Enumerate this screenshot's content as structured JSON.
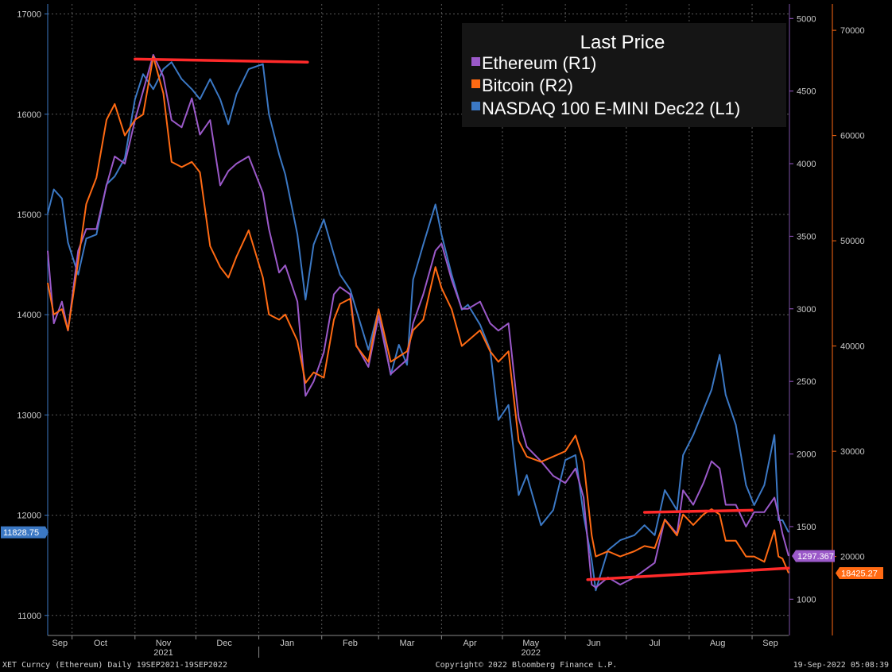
{
  "chart_data": {
    "type": "line",
    "legend": {
      "title": "Last Price",
      "placement": "top-right",
      "items": [
        "Ethereum  (R1)",
        "Bitcoin  (R2)",
        "NASDAQ 100 E-MINI Dec22  (L1)"
      ]
    },
    "axes": {
      "left": {
        "ticks": [
          11000,
          12000,
          13000,
          14000,
          15000,
          16000,
          17000
        ],
        "range": [
          10800,
          17100
        ]
      },
      "right1": {
        "ticks": [
          1000,
          1500,
          2000,
          2500,
          3000,
          3500,
          4000,
          4500,
          5000
        ],
        "range": [
          750,
          5100
        ]
      },
      "right2": {
        "ticks": [
          20000,
          30000,
          40000,
          50000,
          60000,
          70000
        ],
        "range": [
          12500,
          72500
        ]
      }
    },
    "x": {
      "start": "2021-09-19",
      "end": "2022-09-19",
      "month_labels": [
        "Sep",
        "Oct",
        "Nov",
        "Dec",
        "Jan",
        "Feb",
        "Mar",
        "Apr",
        "May",
        "Jun",
        "Jul",
        "Aug",
        "Sep"
      ],
      "year_labels": [
        "2021",
        "2022"
      ],
      "grid": true
    },
    "series": [
      {
        "name": "NASDAQ 100 E-MINI Dec22",
        "axis": "left",
        "color": "#3b78c4",
        "points": [
          [
            "2021-09-19",
            15010
          ],
          [
            "2021-09-22",
            15250
          ],
          [
            "2021-09-26",
            15160
          ],
          [
            "2021-09-29",
            14720
          ],
          [
            "2021-10-04",
            14400
          ],
          [
            "2021-10-08",
            14760
          ],
          [
            "2021-10-13",
            14800
          ],
          [
            "2021-10-18",
            15300
          ],
          [
            "2021-10-22",
            15380
          ],
          [
            "2021-10-27",
            15560
          ],
          [
            "2021-11-01",
            16150
          ],
          [
            "2021-11-05",
            16400
          ],
          [
            "2021-11-10",
            16250
          ],
          [
            "2021-11-15",
            16450
          ],
          [
            "2021-11-19",
            16520
          ],
          [
            "2021-11-24",
            16350
          ],
          [
            "2021-11-29",
            16250
          ],
          [
            "2021-12-03",
            16150
          ],
          [
            "2021-12-08",
            16350
          ],
          [
            "2021-12-13",
            16150
          ],
          [
            "2021-12-17",
            15900
          ],
          [
            "2021-12-21",
            16200
          ],
          [
            "2021-12-27",
            16450
          ],
          [
            "2022-01-03",
            16500
          ],
          [
            "2022-01-06",
            16000
          ],
          [
            "2022-01-11",
            15600
          ],
          [
            "2022-01-14",
            15400
          ],
          [
            "2022-01-20",
            14800
          ],
          [
            "2022-01-24",
            14150
          ],
          [
            "2022-01-28",
            14700
          ],
          [
            "2022-02-02",
            14950
          ],
          [
            "2022-02-07",
            14600
          ],
          [
            "2022-02-10",
            14400
          ],
          [
            "2022-02-15",
            14250
          ],
          [
            "2022-02-18",
            14050
          ],
          [
            "2022-02-24",
            13650
          ],
          [
            "2022-03-01",
            14050
          ],
          [
            "2022-03-07",
            13400
          ],
          [
            "2022-03-11",
            13700
          ],
          [
            "2022-03-15",
            13500
          ],
          [
            "2022-03-18",
            14350
          ],
          [
            "2022-03-23",
            14700
          ],
          [
            "2022-03-29",
            15100
          ],
          [
            "2022-04-01",
            14800
          ],
          [
            "2022-04-06",
            14400
          ],
          [
            "2022-04-11",
            14050
          ],
          [
            "2022-04-14",
            14100
          ],
          [
            "2022-04-20",
            13900
          ],
          [
            "2022-04-25",
            13650
          ],
          [
            "2022-04-29",
            12950
          ],
          [
            "2022-05-04",
            13100
          ],
          [
            "2022-05-09",
            12200
          ],
          [
            "2022-05-13",
            12400
          ],
          [
            "2022-05-20",
            11900
          ],
          [
            "2022-05-26",
            12050
          ],
          [
            "2022-06-01",
            12550
          ],
          [
            "2022-06-06",
            12600
          ],
          [
            "2022-06-10",
            12000
          ],
          [
            "2022-06-14",
            11550
          ],
          [
            "2022-06-16",
            11250
          ],
          [
            "2022-06-22",
            11650
          ],
          [
            "2022-06-28",
            11750
          ],
          [
            "2022-07-05",
            11800
          ],
          [
            "2022-07-10",
            11900
          ],
          [
            "2022-07-15",
            11800
          ],
          [
            "2022-07-20",
            12250
          ],
          [
            "2022-07-26",
            12050
          ],
          [
            "2022-07-29",
            12600
          ],
          [
            "2022-08-03",
            12800
          ],
          [
            "2022-08-08",
            13050
          ],
          [
            "2022-08-12",
            13250
          ],
          [
            "2022-08-16",
            13600
          ],
          [
            "2022-08-19",
            13200
          ],
          [
            "2022-08-24",
            12900
          ],
          [
            "2022-08-29",
            12300
          ],
          [
            "2022-09-02",
            12100
          ],
          [
            "2022-09-07",
            12300
          ],
          [
            "2022-09-12",
            12800
          ],
          [
            "2022-09-14",
            11950
          ],
          [
            "2022-09-16",
            11950
          ],
          [
            "2022-09-19",
            11828.75
          ]
        ]
      },
      {
        "name": "Ethereum",
        "axis": "right1",
        "color": "#9b59c9",
        "points": [
          [
            "2021-09-19",
            3400
          ],
          [
            "2021-09-22",
            2900
          ],
          [
            "2021-09-26",
            3050
          ],
          [
            "2021-09-29",
            2850
          ],
          [
            "2021-10-04",
            3400
          ],
          [
            "2021-10-08",
            3550
          ],
          [
            "2021-10-13",
            3550
          ],
          [
            "2021-10-18",
            3850
          ],
          [
            "2021-10-22",
            4050
          ],
          [
            "2021-10-27",
            4000
          ],
          [
            "2021-11-01",
            4300
          ],
          [
            "2021-11-05",
            4500
          ],
          [
            "2021-11-10",
            4750
          ],
          [
            "2021-11-15",
            4600
          ],
          [
            "2021-11-19",
            4300
          ],
          [
            "2021-11-24",
            4250
          ],
          [
            "2021-11-29",
            4450
          ],
          [
            "2021-12-03",
            4200
          ],
          [
            "2021-12-08",
            4300
          ],
          [
            "2021-12-13",
            3850
          ],
          [
            "2021-12-17",
            3950
          ],
          [
            "2021-12-21",
            4000
          ],
          [
            "2021-12-27",
            4050
          ],
          [
            "2022-01-03",
            3800
          ],
          [
            "2022-01-06",
            3550
          ],
          [
            "2022-01-11",
            3250
          ],
          [
            "2022-01-14",
            3300
          ],
          [
            "2022-01-20",
            3050
          ],
          [
            "2022-01-24",
            2400
          ],
          [
            "2022-01-28",
            2500
          ],
          [
            "2022-02-02",
            2700
          ],
          [
            "2022-02-07",
            3100
          ],
          [
            "2022-02-10",
            3150
          ],
          [
            "2022-02-15",
            3100
          ],
          [
            "2022-02-18",
            2750
          ],
          [
            "2022-02-24",
            2600
          ],
          [
            "2022-03-01",
            2950
          ],
          [
            "2022-03-07",
            2550
          ],
          [
            "2022-03-11",
            2600
          ],
          [
            "2022-03-15",
            2650
          ],
          [
            "2022-03-18",
            2900
          ],
          [
            "2022-03-23",
            3100
          ],
          [
            "2022-03-29",
            3400
          ],
          [
            "2022-04-01",
            3450
          ],
          [
            "2022-04-06",
            3200
          ],
          [
            "2022-04-11",
            3000
          ],
          [
            "2022-04-14",
            3000
          ],
          [
            "2022-04-20",
            3050
          ],
          [
            "2022-04-25",
            2900
          ],
          [
            "2022-04-29",
            2850
          ],
          [
            "2022-05-04",
            2900
          ],
          [
            "2022-05-09",
            2250
          ],
          [
            "2022-05-13",
            2050
          ],
          [
            "2022-05-20",
            1950
          ],
          [
            "2022-05-26",
            1850
          ],
          [
            "2022-06-01",
            1800
          ],
          [
            "2022-06-06",
            1900
          ],
          [
            "2022-06-10",
            1700
          ],
          [
            "2022-06-14",
            1100
          ],
          [
            "2022-06-16",
            1080
          ],
          [
            "2022-06-22",
            1150
          ],
          [
            "2022-06-28",
            1100
          ],
          [
            "2022-07-05",
            1150
          ],
          [
            "2022-07-10",
            1200
          ],
          [
            "2022-07-15",
            1250
          ],
          [
            "2022-07-20",
            1550
          ],
          [
            "2022-07-26",
            1450
          ],
          [
            "2022-07-29",
            1750
          ],
          [
            "2022-08-03",
            1650
          ],
          [
            "2022-08-08",
            1800
          ],
          [
            "2022-08-12",
            1950
          ],
          [
            "2022-08-16",
            1900
          ],
          [
            "2022-08-19",
            1650
          ],
          [
            "2022-08-24",
            1650
          ],
          [
            "2022-08-29",
            1500
          ],
          [
            "2022-09-02",
            1600
          ],
          [
            "2022-09-07",
            1600
          ],
          [
            "2022-09-12",
            1700
          ],
          [
            "2022-09-14",
            1580
          ],
          [
            "2022-09-16",
            1450
          ],
          [
            "2022-09-19",
            1297.367
          ]
        ]
      },
      {
        "name": "Bitcoin",
        "axis": "right2",
        "color": "#ff6a13",
        "points": [
          [
            "2021-09-19",
            46000
          ],
          [
            "2021-09-22",
            43000
          ],
          [
            "2021-09-26",
            43500
          ],
          [
            "2021-09-29",
            41500
          ],
          [
            "2021-10-04",
            48000
          ],
          [
            "2021-10-08",
            53500
          ],
          [
            "2021-10-13",
            56000
          ],
          [
            "2021-10-18",
            61500
          ],
          [
            "2021-10-22",
            63000
          ],
          [
            "2021-10-27",
            60000
          ],
          [
            "2021-11-01",
            61500
          ],
          [
            "2021-11-05",
            62000
          ],
          [
            "2021-11-10",
            67500
          ],
          [
            "2021-11-15",
            64000
          ],
          [
            "2021-11-19",
            57500
          ],
          [
            "2021-11-24",
            57000
          ],
          [
            "2021-11-29",
            57500
          ],
          [
            "2021-12-03",
            56500
          ],
          [
            "2021-12-08",
            49500
          ],
          [
            "2021-12-13",
            47500
          ],
          [
            "2021-12-17",
            46500
          ],
          [
            "2021-12-21",
            48500
          ],
          [
            "2021-12-27",
            51000
          ],
          [
            "2022-01-03",
            46500
          ],
          [
            "2022-01-06",
            43000
          ],
          [
            "2022-01-11",
            42500
          ],
          [
            "2022-01-14",
            43000
          ],
          [
            "2022-01-20",
            40500
          ],
          [
            "2022-01-24",
            36500
          ],
          [
            "2022-01-28",
            37500
          ],
          [
            "2022-02-02",
            37000
          ],
          [
            "2022-02-07",
            42500
          ],
          [
            "2022-02-10",
            44000
          ],
          [
            "2022-02-15",
            44500
          ],
          [
            "2022-02-18",
            40000
          ],
          [
            "2022-02-24",
            38500
          ],
          [
            "2022-03-01",
            43500
          ],
          [
            "2022-03-07",
            38500
          ],
          [
            "2022-03-11",
            39000
          ],
          [
            "2022-03-15",
            39500
          ],
          [
            "2022-03-18",
            41500
          ],
          [
            "2022-03-23",
            42500
          ],
          [
            "2022-03-29",
            47500
          ],
          [
            "2022-04-01",
            45500
          ],
          [
            "2022-04-06",
            43500
          ],
          [
            "2022-04-11",
            40000
          ],
          [
            "2022-04-14",
            40500
          ],
          [
            "2022-04-20",
            41500
          ],
          [
            "2022-04-25",
            39500
          ],
          [
            "2022-04-29",
            38500
          ],
          [
            "2022-05-04",
            39500
          ],
          [
            "2022-05-09",
            31000
          ],
          [
            "2022-05-13",
            29500
          ],
          [
            "2022-05-20",
            29000
          ],
          [
            "2022-05-26",
            29500
          ],
          [
            "2022-06-01",
            30000
          ],
          [
            "2022-06-06",
            31500
          ],
          [
            "2022-06-10",
            29000
          ],
          [
            "2022-06-14",
            22000
          ],
          [
            "2022-06-16",
            20000
          ],
          [
            "2022-06-22",
            20500
          ],
          [
            "2022-06-28",
            20000
          ],
          [
            "2022-07-05",
            20500
          ],
          [
            "2022-07-10",
            21000
          ],
          [
            "2022-07-15",
            20800
          ],
          [
            "2022-07-20",
            23500
          ],
          [
            "2022-07-26",
            22000
          ],
          [
            "2022-07-29",
            24000
          ],
          [
            "2022-08-03",
            23000
          ],
          [
            "2022-08-08",
            24000
          ],
          [
            "2022-08-12",
            24500
          ],
          [
            "2022-08-16",
            24000
          ],
          [
            "2022-08-19",
            21500
          ],
          [
            "2022-08-24",
            21500
          ],
          [
            "2022-08-29",
            20000
          ],
          [
            "2022-09-02",
            20000
          ],
          [
            "2022-09-07",
            19500
          ],
          [
            "2022-09-12",
            22500
          ],
          [
            "2022-09-14",
            20000
          ],
          [
            "2022-09-16",
            19800
          ],
          [
            "2022-09-19",
            18425.27
          ]
        ]
      }
    ],
    "annotations": [
      {
        "kind": "trendline",
        "axis": "left",
        "color": "#ff2a2a",
        "from": [
          "2021-11-01",
          16550
        ],
        "to": [
          "2022-01-25",
          16520
        ]
      },
      {
        "kind": "trendline",
        "axis": "right2",
        "color": "#ff2a2a",
        "from": [
          "2022-07-10",
          24200
        ],
        "to": [
          "2022-09-01",
          24400
        ]
      },
      {
        "kind": "trendline",
        "axis": "right2",
        "color": "#ff2a2a",
        "from": [
          "2022-06-12",
          17800
        ],
        "to": [
          "2022-09-19",
          18900
        ]
      }
    ],
    "last_price_labels": [
      {
        "axis": "left",
        "value": "11828.75",
        "color": "#3b78c4"
      },
      {
        "axis": "right1",
        "value": "1297.367",
        "color": "#9b59c9"
      },
      {
        "axis": "right2",
        "value": "18425.27",
        "color": "#ff6a13"
      }
    ]
  },
  "footer": {
    "left": "XET Curncy (Ethereum)  Daily 19SEP2021-19SEP2022",
    "center": "Copyright© 2022 Bloomberg Finance L.P.",
    "right": "19-Sep-2022 05:08:39"
  }
}
